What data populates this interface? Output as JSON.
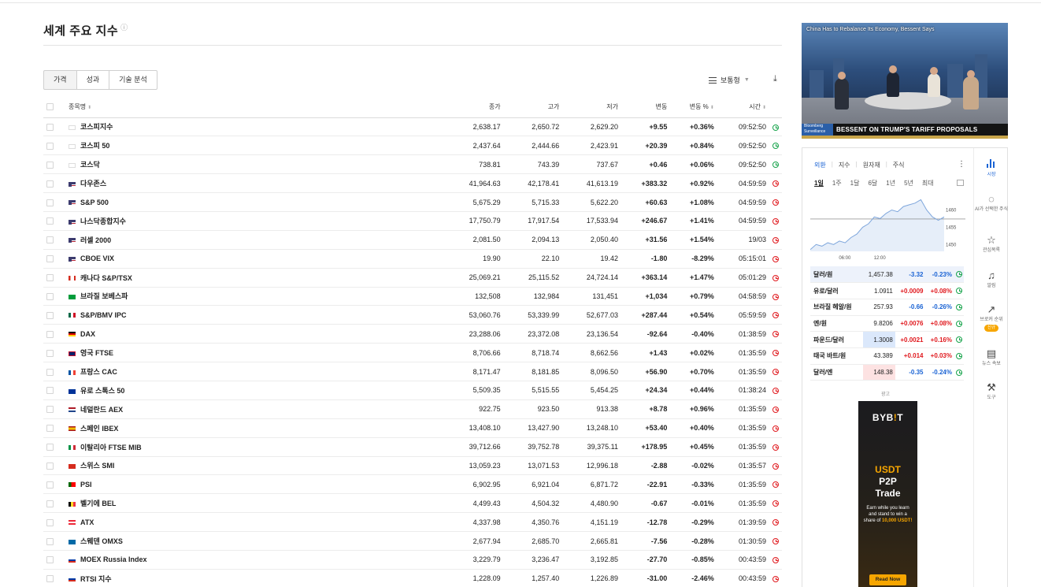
{
  "page": {
    "title": "세계 주요 지수",
    "info_glyph": "ⓘ",
    "tabs": [
      "가격",
      "성과",
      "기술 분석"
    ],
    "view_mode": "보통형",
    "download_glyph": "⤓"
  },
  "table": {
    "headers": {
      "name": "종목명",
      "close": "종가",
      "high": "고가",
      "low": "저가",
      "change": "변동",
      "change_pct": "변동 %",
      "time": "시간"
    },
    "rows": [
      {
        "name": "코스피지수",
        "flag": "kr",
        "close": "2,638.17",
        "high": "2,650.72",
        "low": "2,629.20",
        "change": "+9.55",
        "pct": "+0.36%",
        "time": "09:52:50",
        "dir": "up",
        "status": "open"
      },
      {
        "name": "코스피 50",
        "flag": "kr",
        "close": "2,437.64",
        "high": "2,444.66",
        "low": "2,423.91",
        "change": "+20.39",
        "pct": "+0.84%",
        "time": "09:52:50",
        "dir": "up",
        "status": "open"
      },
      {
        "name": "코스닥",
        "flag": "kr",
        "close": "738.81",
        "high": "743.39",
        "low": "737.67",
        "change": "+0.46",
        "pct": "+0.06%",
        "time": "09:52:50",
        "dir": "up",
        "status": "open"
      },
      {
        "name": "다우존스",
        "flag": "us",
        "close": "41,964.63",
        "high": "42,178.41",
        "low": "41,613.19",
        "change": "+383.32",
        "pct": "+0.92%",
        "time": "04:59:59",
        "dir": "up",
        "status": "closed"
      },
      {
        "name": "S&P 500",
        "flag": "us",
        "close": "5,675.29",
        "high": "5,715.33",
        "low": "5,622.20",
        "change": "+60.63",
        "pct": "+1.08%",
        "time": "04:59:59",
        "dir": "up",
        "status": "closed"
      },
      {
        "name": "나스닥종합지수",
        "flag": "us",
        "close": "17,750.79",
        "high": "17,917.54",
        "low": "17,533.94",
        "change": "+246.67",
        "pct": "+1.41%",
        "time": "04:59:59",
        "dir": "up",
        "status": "closed"
      },
      {
        "name": "러셀 2000",
        "flag": "us",
        "close": "2,081.50",
        "high": "2,094.13",
        "low": "2,050.40",
        "change": "+31.56",
        "pct": "+1.54%",
        "time": "19/03",
        "dir": "up",
        "status": "closed"
      },
      {
        "name": "CBOE VIX",
        "flag": "us",
        "close": "19.90",
        "high": "22.10",
        "low": "19.42",
        "change": "-1.80",
        "pct": "-8.29%",
        "time": "05:15:01",
        "dir": "dn",
        "status": "closed"
      },
      {
        "name": "캐나다 S&P/TSX",
        "flag": "ca",
        "close": "25,069.21",
        "high": "25,115.52",
        "low": "24,724.14",
        "change": "+363.14",
        "pct": "+1.47%",
        "time": "05:01:29",
        "dir": "up",
        "status": "closed"
      },
      {
        "name": "브라질 보베스파",
        "flag": "br",
        "close": "132,508",
        "high": "132,984",
        "low": "131,451",
        "change": "+1,034",
        "pct": "+0.79%",
        "time": "04:58:59",
        "dir": "up",
        "status": "closed"
      },
      {
        "name": "S&P/BMV IPC",
        "flag": "mx",
        "close": "53,060.76",
        "high": "53,339.99",
        "low": "52,677.03",
        "change": "+287.44",
        "pct": "+0.54%",
        "time": "05:59:59",
        "dir": "up",
        "status": "closed"
      },
      {
        "name": "DAX",
        "flag": "de",
        "close": "23,288.06",
        "high": "23,372.08",
        "low": "23,136.54",
        "change": "-92.64",
        "pct": "-0.40%",
        "time": "01:38:59",
        "dir": "dn",
        "status": "closed"
      },
      {
        "name": "영국 FTSE",
        "flag": "gb",
        "close": "8,706.66",
        "high": "8,718.74",
        "low": "8,662.56",
        "change": "+1.43",
        "pct": "+0.02%",
        "time": "01:35:59",
        "dir": "up",
        "status": "closed"
      },
      {
        "name": "프랑스 CAC",
        "flag": "fr",
        "close": "8,171.47",
        "high": "8,181.85",
        "low": "8,096.50",
        "change": "+56.90",
        "pct": "+0.70%",
        "time": "01:35:59",
        "dir": "up",
        "status": "closed"
      },
      {
        "name": "유로 스톡스 50",
        "flag": "eu",
        "close": "5,509.35",
        "high": "5,515.55",
        "low": "5,454.25",
        "change": "+24.34",
        "pct": "+0.44%",
        "time": "01:38:24",
        "dir": "up",
        "status": "closed"
      },
      {
        "name": "네덜란드 AEX",
        "flag": "nl",
        "close": "922.75",
        "high": "923.50",
        "low": "913.38",
        "change": "+8.78",
        "pct": "+0.96%",
        "time": "01:35:59",
        "dir": "up",
        "status": "closed"
      },
      {
        "name": "스페인 IBEX",
        "flag": "es",
        "close": "13,408.10",
        "high": "13,427.90",
        "low": "13,248.10",
        "change": "+53.40",
        "pct": "+0.40%",
        "time": "01:35:59",
        "dir": "up",
        "status": "closed"
      },
      {
        "name": "이탈리아 FTSE MIB",
        "flag": "it",
        "close": "39,712.66",
        "high": "39,752.78",
        "low": "39,375.11",
        "change": "+178.95",
        "pct": "+0.45%",
        "time": "01:35:59",
        "dir": "up",
        "status": "closed"
      },
      {
        "name": "스위스 SMI",
        "flag": "ch",
        "close": "13,059.23",
        "high": "13,071.53",
        "low": "12,996.18",
        "change": "-2.88",
        "pct": "-0.02%",
        "time": "01:35:57",
        "dir": "dn",
        "status": "closed"
      },
      {
        "name": "PSI",
        "flag": "pt",
        "close": "6,902.95",
        "high": "6,921.04",
        "low": "6,871.72",
        "change": "-22.91",
        "pct": "-0.33%",
        "time": "01:35:59",
        "dir": "dn",
        "status": "closed"
      },
      {
        "name": "벨기에 BEL",
        "flag": "be",
        "close": "4,499.43",
        "high": "4,504.32",
        "low": "4,480.90",
        "change": "-0.67",
        "pct": "-0.01%",
        "time": "01:35:59",
        "dir": "dn",
        "status": "closed"
      },
      {
        "name": "ATX",
        "flag": "at",
        "close": "4,337.98",
        "high": "4,350.76",
        "low": "4,151.19",
        "change": "-12.78",
        "pct": "-0.29%",
        "time": "01:39:59",
        "dir": "dn",
        "status": "closed"
      },
      {
        "name": "스웨덴 OMXS",
        "flag": "se",
        "close": "2,677.94",
        "high": "2,685.70",
        "low": "2,665.81",
        "change": "-7.56",
        "pct": "-0.28%",
        "time": "01:30:59",
        "dir": "dn",
        "status": "closed"
      },
      {
        "name": "MOEX Russia Index",
        "flag": "ru",
        "close": "3,229.79",
        "high": "3,236.47",
        "low": "3,192.85",
        "change": "-27.70",
        "pct": "-0.85%",
        "time": "00:43:59",
        "dir": "dn",
        "status": "closed"
      },
      {
        "name": "RTSI 지수",
        "flag": "ru",
        "close": "1,228.09",
        "high": "1,257.40",
        "low": "1,226.89",
        "change": "-31.00",
        "pct": "-2.46%",
        "time": "00:43:59",
        "dir": "dn",
        "status": "closed"
      }
    ]
  },
  "video": {
    "headline": "China Has to Rebalance Its Economy, Bessent Says",
    "brand": "Bloomberg Surveillance",
    "lower_third": "BESSENT ON TRUMP'S TARIFF PROPOSALS"
  },
  "widget": {
    "tabs": [
      "외환",
      "지수",
      "원자재",
      "주식"
    ],
    "menu_glyph": "⋮",
    "periods": [
      "1일",
      "1주",
      "1달",
      "6달",
      "1년",
      "5년",
      "최대"
    ],
    "chart_times": [
      "06:00",
      "12:00"
    ],
    "chart_levels": [
      "1460",
      "1455",
      "1450"
    ],
    "rates": [
      {
        "name": "달러/원",
        "value": "1,457.38",
        "change": "-3.32",
        "pct": "-0.23%",
        "dir": "dn",
        "hl": ""
      },
      {
        "name": "유로/달러",
        "value": "1.0911",
        "change": "+0.0009",
        "pct": "+0.08%",
        "dir": "up",
        "hl": ""
      },
      {
        "name": "브라질 헤알/원",
        "value": "257.93",
        "change": "-0.66",
        "pct": "-0.26%",
        "dir": "dn",
        "hl": ""
      },
      {
        "name": "엔/원",
        "value": "9.8206",
        "change": "+0.0076",
        "pct": "+0.08%",
        "dir": "up",
        "hl": ""
      },
      {
        "name": "파운드/달러",
        "value": "1.3008",
        "change": "+0.0021",
        "pct": "+0.16%",
        "dir": "up",
        "hl": "blue"
      },
      {
        "name": "태국 바트/원",
        "value": "43.389",
        "change": "+0.014",
        "pct": "+0.03%",
        "dir": "up",
        "hl": ""
      },
      {
        "name": "달러/엔",
        "value": "148.38",
        "change": "-0.35",
        "pct": "-0.24%",
        "dir": "dn",
        "hl": "red"
      }
    ],
    "ad_label": "광고",
    "sidebar": [
      {
        "label": "시장",
        "icon": "bar-chart-icon"
      },
      {
        "label": "AI가 선택한 주식",
        "icon": "lightbulb-icon"
      },
      {
        "label": "관심목록",
        "icon": "star-icon"
      },
      {
        "label": "알림",
        "icon": "bell-icon"
      },
      {
        "label": "브로커 순위",
        "icon": "trend-icon",
        "badge": "신규"
      },
      {
        "label": "뉴스 속보",
        "icon": "news-icon"
      },
      {
        "label": "도구",
        "icon": "wrench-icon"
      }
    ]
  },
  "ad": {
    "logo_a": "BYB",
    "logo_bar": "!",
    "logo_b": "T",
    "line1": "USDT",
    "line2": "P2P",
    "line3": "Trade",
    "body": "Earn while you learn and stand to win a share of",
    "body_highlight": "10,000 USDT!",
    "cta": "Read Now"
  },
  "chart_data": {
    "type": "line",
    "x": [
      "00:00",
      "01:00",
      "02:00",
      "03:00",
      "04:00",
      "05:00",
      "06:00",
      "07:00",
      "08:00",
      "09:00",
      "10:00",
      "11:00",
      "12:00",
      "13:00",
      "14:00",
      "15:00",
      "16:00",
      "17:00",
      "18:00",
      "19:00",
      "20:00",
      "21:00",
      "22:00",
      "23:00"
    ],
    "values": [
      1448.5,
      1450,
      1449.5,
      1450.5,
      1450,
      1451,
      1450.5,
      1452,
      1453,
      1455,
      1456,
      1458,
      1457.5,
      1459,
      1460,
      1459.5,
      1461,
      1461.5,
      1462,
      1463,
      1460,
      1458,
      1457,
      1458
    ],
    "reference_line": 1457.38,
    "ylim": [
      1448,
      1464
    ],
    "y_ticks": [
      1450,
      1455,
      1460
    ],
    "x_ticks": [
      "06:00",
      "12:00"
    ],
    "grid": false
  }
}
